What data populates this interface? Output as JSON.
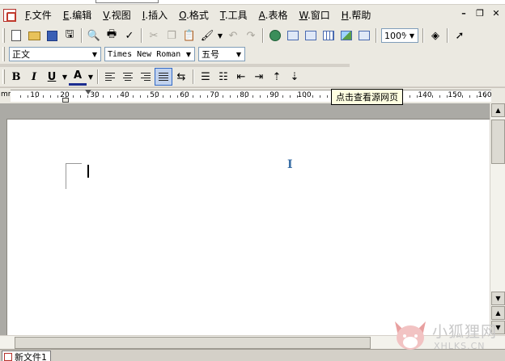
{
  "menu": {
    "items": [
      {
        "key": "F",
        "label": ".文件"
      },
      {
        "key": "E",
        "label": ".编辑"
      },
      {
        "key": "V",
        "label": ".视图"
      },
      {
        "key": "I",
        "label": ".插入"
      },
      {
        "key": "O",
        "label": ".格式"
      },
      {
        "key": "T",
        "label": ".工具"
      },
      {
        "key": "A",
        "label": ".表格"
      },
      {
        "key": "W",
        "label": ".窗口"
      },
      {
        "key": "H",
        "label": ".帮助"
      }
    ],
    "controls": {
      "minimize": "–",
      "restore": "❐",
      "close": "✕"
    }
  },
  "toolbar": {
    "zoom": "100%",
    "style": "正文",
    "font": "Times New Roman",
    "size": "五号",
    "bold": "B",
    "italic": "I",
    "underline": "U",
    "font_color": "A",
    "font_color_hex": "#1b2d8f"
  },
  "ruler": {
    "unit": "mm",
    "labels": [
      "10",
      "20",
      "30",
      "40",
      "50",
      "60",
      "70",
      "80",
      "90",
      "100",
      "140",
      "150",
      "160"
    ],
    "tooltip": "点击查看源网页"
  },
  "document": {
    "tab_label": "新文件1"
  },
  "watermark": {
    "title": "小狐狸网",
    "domain": "XHLKS.CN"
  }
}
